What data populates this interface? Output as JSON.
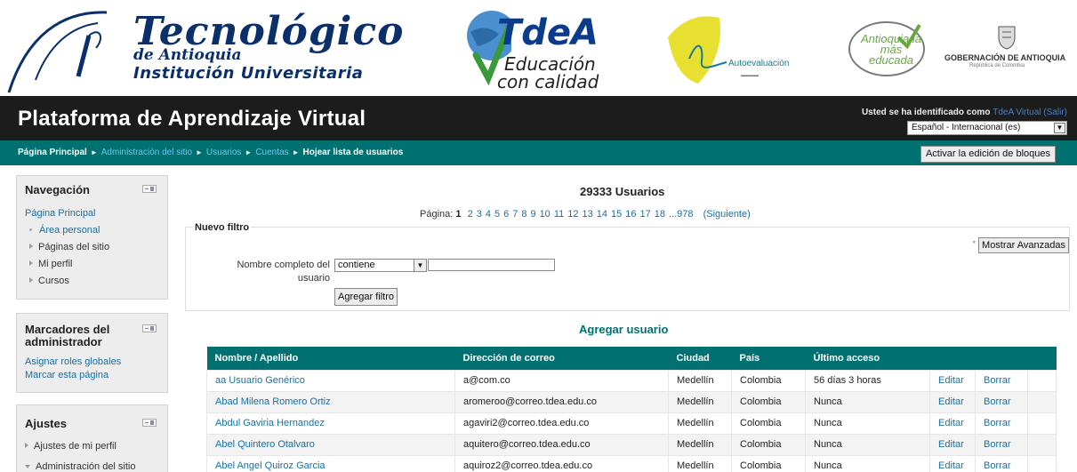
{
  "banner": {
    "tda_line1": "Tecnológico",
    "tda_line2": "de Antioquia",
    "tda_line3": "Institución Universitaria",
    "tdea_name": "TdeA",
    "tdea_slogan1": "Educación",
    "tdea_slogan2": "con calidad",
    "autoeval_text": "Autoevaluación",
    "antioquia_text": "Antioquia la más educada",
    "gob_name": "GOBERNACIÓN DE ANTIOQUIA",
    "gob_sub": "República de Colombia"
  },
  "header": {
    "site_title": "Plataforma de Aprendizaje Virtual",
    "login_prefix": "Usted se ha identificado como",
    "user_name": "TdeA Virtual",
    "logout": "Salir",
    "language": "Español - Internacional (es)"
  },
  "navbar": {
    "crumb_home": "Página Principal",
    "crumb_admin": "Administración del sitio",
    "crumb_users": "Usuarios",
    "crumb_accounts": "Cuentas",
    "crumb_current": "Hojear lista de usuarios",
    "separator": "►",
    "edit_blocks": "Activar la edición de bloques"
  },
  "nav_block": {
    "title": "Navegación",
    "home": "Página Principal",
    "items": [
      "Área personal",
      "Páginas del sitio",
      "Mi perfil",
      "Cursos"
    ]
  },
  "bookmarks_block": {
    "title_line1": "Marcadores del",
    "title_line2": "administrador",
    "links": [
      "Asignar roles globales",
      "Marcar esta página"
    ]
  },
  "settings_block": {
    "title": "Ajustes",
    "items": [
      "Ajustes de mi perfil",
      "Administración del sitio"
    ]
  },
  "main": {
    "user_count": "29333 Usuarios",
    "paging_label": "Página:",
    "current_page": "1",
    "pages": [
      "2",
      "3",
      "4",
      "5",
      "6",
      "7",
      "8",
      "9",
      "10",
      "11",
      "12",
      "13",
      "14",
      "15",
      "16",
      "17",
      "18",
      "...978"
    ],
    "next": "(Siguiente)",
    "filter_legend": "Nuevo filtro",
    "advanced_button": "Mostrar Avanzadas",
    "filter_label": "Nombre completo del usuario",
    "filter_operator": "contiene",
    "filter_value": "",
    "add_filter": "Agregar filtro",
    "add_user": "Agregar usuario"
  },
  "table": {
    "headers": [
      "Nombre / Apellido",
      "Dirección de correo",
      "Ciudad",
      "País",
      "Último acceso",
      "",
      "",
      ""
    ],
    "rows": [
      [
        "aa Usuario Genérico",
        "a@com.co",
        "Medellín",
        "Colombia",
        "56 días 3 horas",
        "Editar",
        "Borrar"
      ],
      [
        "Abad Milena Romero Ortiz",
        "aromeroo@correo.tdea.edu.co",
        "Medellín",
        "Colombia",
        "Nunca",
        "Editar",
        "Borrar"
      ],
      [
        "Abdul Gaviria Hernandez",
        "agaviri2@correo.tdea.edu.co",
        "Medellín",
        "Colombia",
        "Nunca",
        "Editar",
        "Borrar"
      ],
      [
        "Abel Quintero Otalvaro",
        "aquitero@correo.tdea.edu.co",
        "Medellín",
        "Colombia",
        "Nunca",
        "Editar",
        "Borrar"
      ],
      [
        "Abel Angel Quiroz Garcia",
        "aquiroz2@correo.tdea.edu.co",
        "Medellín",
        "Colombia",
        "Nunca",
        "Editar",
        "Borrar"
      ]
    ]
  },
  "colors": {
    "header_bg": "#1c1c1c",
    "navbar_bg": "#007070",
    "table_header_bg": "#007070",
    "link": "#1a6fa0"
  }
}
